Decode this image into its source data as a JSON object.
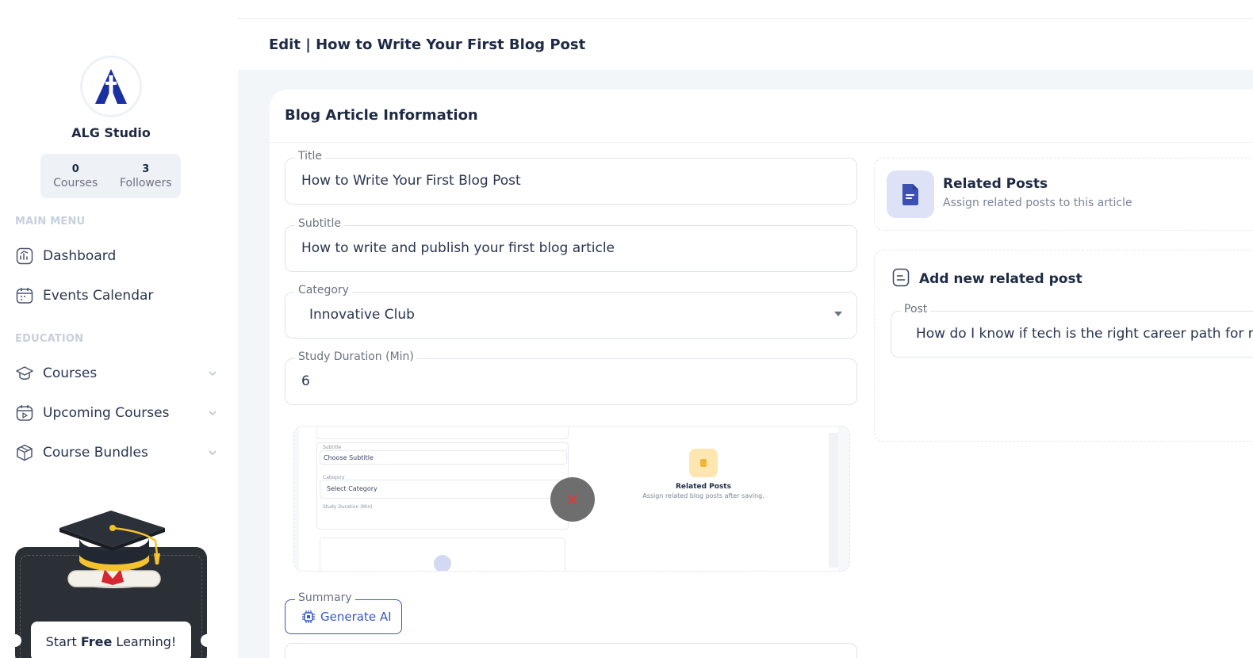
{
  "sidebar": {
    "org_name": "ALG Studio",
    "stats": [
      {
        "value": "0",
        "label": "Courses"
      },
      {
        "value": "3",
        "label": "Followers"
      }
    ],
    "main_menu_heading": "MAIN MENU",
    "main_menu": [
      {
        "label": "Dashboard",
        "icon": "dashboard-icon"
      },
      {
        "label": "Events Calendar",
        "icon": "calendar-icon"
      }
    ],
    "education_heading": "EDUCATION",
    "education": [
      {
        "label": "Courses",
        "icon": "graduation-cap-icon"
      },
      {
        "label": "Upcoming Courses",
        "icon": "video-calendar-icon"
      },
      {
        "label": "Course Bundles",
        "icon": "box-icon"
      }
    ],
    "promo": {
      "prefix": "Start ",
      "bold": "Free",
      "suffix": " Learning!"
    }
  },
  "header": {
    "title": "Edit | How to Write Your First Blog Post"
  },
  "form": {
    "card_title": "Blog Article Information",
    "title": {
      "label": "Title",
      "value": "How to Write Your First Blog Post"
    },
    "subtitle": {
      "label": "Subtitle",
      "value": "How to write and publish your first blog article"
    },
    "category": {
      "label": "Category",
      "value": "Innovative Club"
    },
    "duration": {
      "label": "Study Duration (Min)",
      "value": "6"
    },
    "summary": {
      "label": "Summary",
      "button": "Generate AI"
    }
  },
  "preview": {
    "subtitle_label": "Subtitle",
    "subtitle_value": "Choose Subtitle",
    "category_label": "Category",
    "category_value": "Select Category",
    "duration_label": "Study Duration (Min)",
    "related_title": "Related Posts",
    "related_sub": "Assign related blog posts after saving."
  },
  "related": {
    "title": "Related Posts",
    "subtitle": "Assign related posts to this article",
    "add_title": "Add new related post",
    "post_label": "Post",
    "post_value": "How do I know if tech is the right career path for me?"
  },
  "colors": {
    "accent": "#3957c8",
    "brand": "#1a2fa0",
    "muted_heading": "#c7d0de"
  }
}
